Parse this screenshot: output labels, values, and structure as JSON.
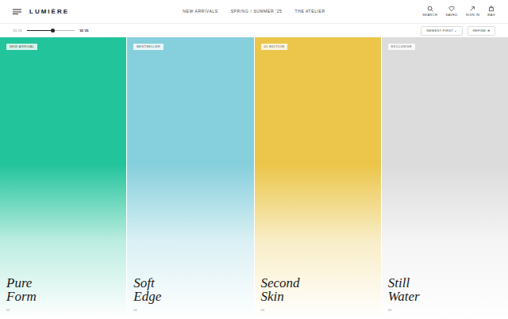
{
  "brand": {
    "logo": "LUMIÈRE"
  },
  "nav": [
    "NEW ARRIVALS",
    "SPRING / SUMMER '25",
    "THE ATELIER"
  ],
  "actions": [
    {
      "label": "SEARCH",
      "icon": "search"
    },
    {
      "label": "SAVED",
      "icon": "heart"
    },
    {
      "label": "SIGN IN",
      "icon": "user"
    },
    {
      "label": "BAG",
      "icon": "bag"
    }
  ],
  "timeline": {
    "start": "'21 '21",
    "end": "'25 '25",
    "level": 0.55
  },
  "sort": {
    "label": "NEWEST FIRST ⌄"
  },
  "refine": {
    "label": "REFINE ⊕"
  },
  "cards": [
    {
      "badge": "NEW ARRIVAL",
      "title_lines": [
        "Pure",
        "Form"
      ],
      "index": "01",
      "color": "#22c49c"
    },
    {
      "badge": "BESTSELLER",
      "title_lines": [
        "Soft",
        "Edge"
      ],
      "index": "02",
      "color": "#86cfdc"
    },
    {
      "badge": "01 EDITION",
      "title_lines": [
        "Second",
        "Skin"
      ],
      "index": "03",
      "color": "#ebc64a"
    },
    {
      "badge": "EXCLUSIVE",
      "title_lines": [
        "Still",
        "Water"
      ],
      "index": "04",
      "color": "#dcdcdc"
    }
  ]
}
